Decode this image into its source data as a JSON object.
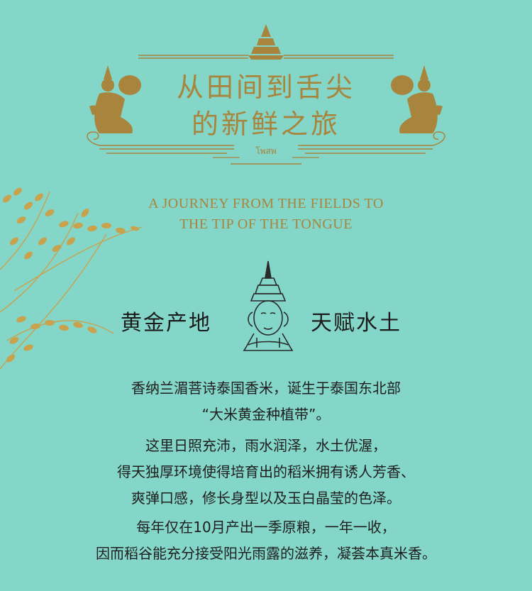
{
  "colors": {
    "background": "#84d6c9",
    "gold": "#a8843d",
    "text": "#1e1e1e"
  },
  "title": {
    "line1": "从田间到舌尖",
    "line2": "的新鲜之旅",
    "thai": "โพสพ"
  },
  "english": {
    "line1": "A JOURNEY FROM THE FIELDS TO",
    "line2": "THE TIP OF THE TONGUE"
  },
  "section": {
    "left": "黄金产地",
    "right": "天赋水土",
    "icon": "thai-deity-head-icon"
  },
  "paragraph": [
    "香纳兰湄菩诗泰国香米，诞生于泰国东北部",
    "“大米黄金种植带”。",
    "这里日照充沛，雨水润泽，水土优渥，",
    "得天独厚环境使得培育出的稻米拥有诱人芳香、",
    "爽弹口感，修长身型以及玉白晶莹的色泽。",
    "每年仅在10月产出一季原粮，一年一收，",
    "因而稻谷能充分接受阳光雨露的滋养，凝荟本真米香。"
  ]
}
